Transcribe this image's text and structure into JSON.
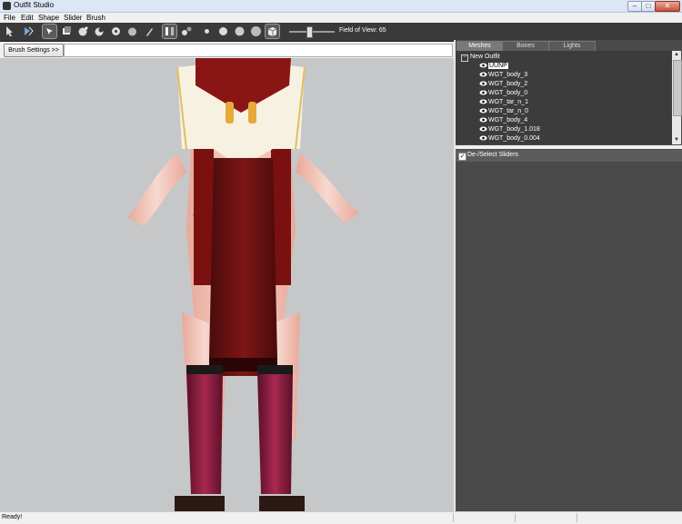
{
  "window": {
    "title": "Outfit Studio"
  },
  "menu": [
    "File",
    "Edit",
    "Shape",
    "Slider",
    "Brush"
  ],
  "toolbar": {
    "icons": [
      "select-brush-icon",
      "transform-icon",
      "pointer-icon",
      "mask-brush-icon",
      "inflate-brush-icon",
      "deflate-brush-icon",
      "move-brush-icon",
      "smooth-brush-icon",
      "weight-brush-icon",
      "vertex-select-icon",
      "segment-icon",
      "sphere-small-icon",
      "sphere-medium-icon",
      "sphere-large-icon",
      "sphere-xlarge-icon",
      "cube-icon"
    ],
    "fov_label": "Field of View: 65",
    "fov_value": 65
  },
  "brush_settings": {
    "label": "Brush Settings >>"
  },
  "tabs": [
    {
      "label": "Meshes",
      "active": true
    },
    {
      "label": "Bones",
      "active": false
    },
    {
      "label": "Lights",
      "active": false
    }
  ],
  "tree": {
    "root": "New Outfit",
    "items": [
      {
        "label": "UUNP",
        "selected": true
      },
      {
        "label": "WGT_body_3",
        "selected": false
      },
      {
        "label": "WGT_body_2",
        "selected": false
      },
      {
        "label": "WGT_body_0",
        "selected": false
      },
      {
        "label": "WGT_tar_n_1",
        "selected": false
      },
      {
        "label": "WGT_tar_n_0",
        "selected": false
      },
      {
        "label": "WGT_body_4",
        "selected": false
      },
      {
        "label": "WGT_body_1.018",
        "selected": false
      },
      {
        "label": "WGT_body_0.004",
        "selected": false
      }
    ]
  },
  "sliders": {
    "label": "De-/Select Sliders",
    "checked": true
  },
  "status": {
    "text": "Ready!"
  }
}
